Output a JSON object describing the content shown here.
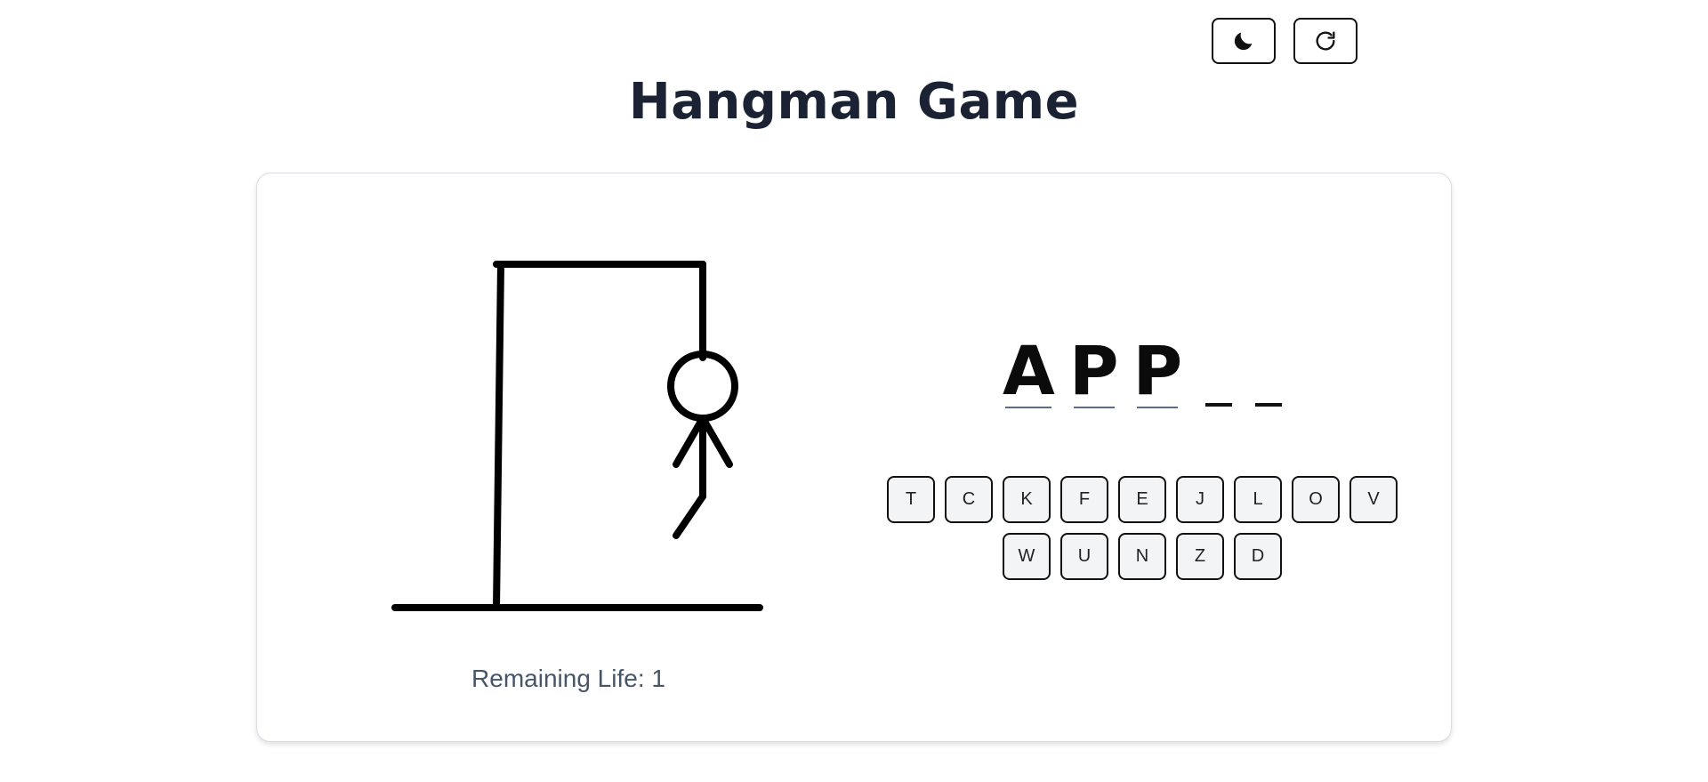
{
  "header": {
    "title": "Hangman Game",
    "theme_toggle_icon": "moon-icon",
    "restart_icon": "refresh-icon"
  },
  "game": {
    "word_letters": [
      "A",
      "P",
      "P",
      "",
      ""
    ],
    "remaining_life_label": "Remaining Life: 1",
    "keyboard_rows": [
      [
        "T",
        "C",
        "K",
        "F",
        "E",
        "J",
        "L",
        "O",
        "V"
      ],
      [
        "W",
        "U",
        "N",
        "Z",
        "D"
      ]
    ]
  },
  "colors": {
    "title": "#1a2233",
    "key_bg": "#f3f4f6",
    "lives_text": "#475569"
  }
}
